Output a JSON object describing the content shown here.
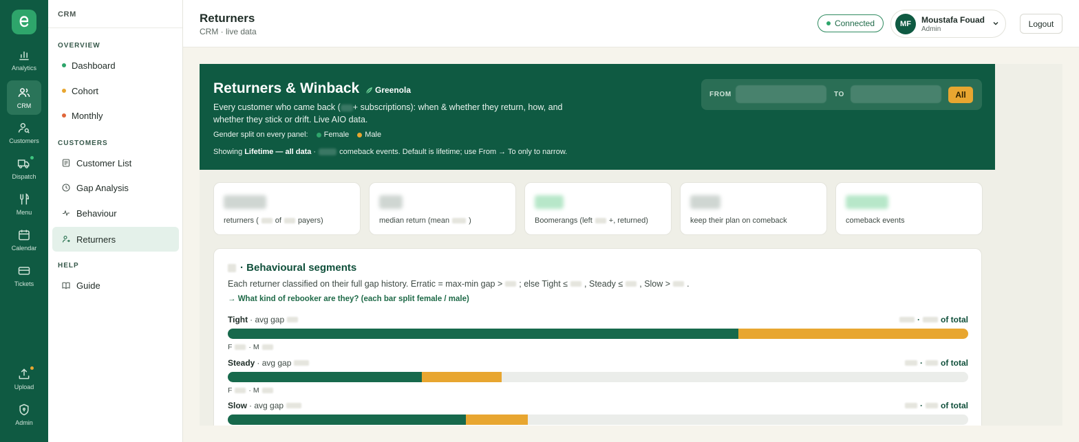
{
  "rail": {
    "items": [
      {
        "label": "Analytics",
        "icon": "bar-chart-icon"
      },
      {
        "label": "CRM",
        "icon": "users-icon"
      },
      {
        "label": "Customers",
        "icon": "user-search-icon"
      },
      {
        "label": "Dispatch",
        "icon": "truck-icon"
      },
      {
        "label": "Menu",
        "icon": "utensils-icon"
      },
      {
        "label": "Calendar",
        "icon": "calendar-icon"
      },
      {
        "label": "Tickets",
        "icon": "ticket-icon"
      },
      {
        "label": "Upload",
        "icon": "upload-icon"
      },
      {
        "label": "Admin",
        "icon": "shield-icon"
      }
    ]
  },
  "sidebar": {
    "header": "CRM",
    "sections": [
      "OVERVIEW",
      "CUSTOMERS",
      "HELP"
    ],
    "items": [
      {
        "label": "Dashboard",
        "color": "#2ea56b"
      },
      {
        "label": "Cohort",
        "color": "#e8a630"
      },
      {
        "label": "Monthly",
        "color": "#e0663a"
      },
      {
        "label": "Customer List",
        "icon": "list-icon"
      },
      {
        "label": "Gap Analysis",
        "icon": "clock-icon"
      },
      {
        "label": "Behaviour",
        "icon": "activity-icon"
      },
      {
        "label": "Returners",
        "icon": "user-return-icon"
      },
      {
        "label": "Guide",
        "icon": "book-icon"
      }
    ]
  },
  "header": {
    "title": "Returners",
    "subtitle": "CRM · live data",
    "status": "Connected",
    "user": {
      "initials": "MF",
      "name": "Moustafa Fouad",
      "role": "Admin"
    },
    "logout": "Logout"
  },
  "hero": {
    "title": "Returners & Winback",
    "brand": "Greenola",
    "desc_part1": "Every customer who came back (",
    "desc_part2": "+ subscriptions): when & whether they return, how, and whether they stick or drift. Live AIO data.",
    "gender_label": "Gender split on every panel:",
    "female": "Female",
    "male": "Male",
    "showing_prefix": "Showing",
    "showing_range": "Lifetime — all data",
    "showing_sep": "·",
    "showing_suffix": "comeback events. Default is lifetime; use From → To only to narrow.",
    "from_label": "FROM",
    "to_label": "TO",
    "all_button": "All"
  },
  "kpis": [
    {
      "a": "returners (",
      "b": "of",
      "c": "payers)",
      "color": "#cfd6d2"
    },
    {
      "a": "median return (mean",
      "b": "",
      "c": ")",
      "color": "#cfd6d2"
    },
    {
      "a": "Boomerangs (left",
      "b": "",
      "c": "+, returned)",
      "color": "#b7e7c9"
    },
    {
      "a": "keep their plan on comeback",
      "b": "",
      "c": "",
      "color": "#cfd6d2"
    },
    {
      "a": "comeback events",
      "b": "",
      "c": "",
      "color": "#b7e7c9"
    }
  ],
  "segments": {
    "title": "· Behavioural segments",
    "desc_1": "Each returner classified on their full gap history. Erratic = max-min gap >",
    "desc_2": "; else Tight ≤",
    "desc_3": ", Steady ≤",
    "desc_4": ", Slow >",
    "desc_5": ".",
    "link": "→ What kind of rebooker are they? (each bar split female / male)",
    "avg_gap": "· avg gap",
    "of_total": "of total",
    "f_label": "F",
    "m_label": "· M",
    "rows": [
      {
        "name": "Tight",
        "female_frac": 0.69,
        "male_frac": 0.31
      },
      {
        "name": "Steady",
        "female_frac": 0.262,
        "male_frac": 0.108
      },
      {
        "name": "Slow",
        "female_frac": 0.322,
        "male_frac": 0.083
      }
    ]
  },
  "colors": {
    "brand_green": "#0f5a42",
    "female": "#17694c",
    "male": "#e8a630"
  }
}
